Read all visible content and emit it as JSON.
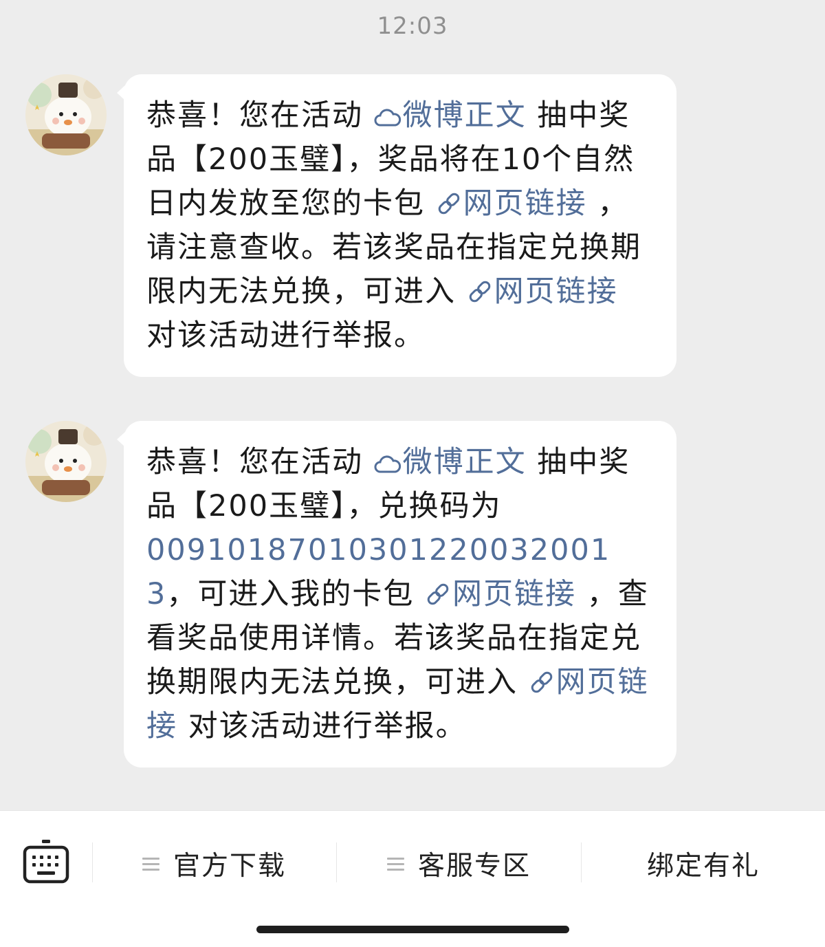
{
  "status": {
    "time": "12:03"
  },
  "messages": [
    {
      "parts": [
        {
          "t": "text",
          "v": "恭喜！您在活动 "
        },
        {
          "t": "weibo",
          "v": "微博正文"
        },
        {
          "t": "text",
          "v": " 抽中奖品【200玉璧】，奖品将在10个自然日内发放至您的卡包 "
        },
        {
          "t": "link",
          "v": "网页链接"
        },
        {
          "t": "text",
          "v": " ，请注意查收。若该奖品在指定兑换期限内无法兑换，可进入 "
        },
        {
          "t": "link",
          "v": "网页链接"
        },
        {
          "t": "text",
          "v": " 对该活动进行举报。"
        }
      ]
    },
    {
      "parts": [
        {
          "t": "text",
          "v": "恭喜！您在活动 "
        },
        {
          "t": "weibo",
          "v": "微博正文"
        },
        {
          "t": "text",
          "v": " 抽中奖品【200玉璧】，兑换码为"
        },
        {
          "t": "code",
          "v": "00910187010301220032001 3"
        },
        {
          "t": "text",
          "v": "，可进入我的卡包 "
        },
        {
          "t": "link",
          "v": "网页链接"
        },
        {
          "t": "text",
          "v": " ，查看奖品使用详情。若该奖品在指定兑换期限内无法兑换，可进入 "
        },
        {
          "t": "link",
          "v": "网页链接"
        },
        {
          "t": "text",
          "v": " 对该活动进行举报。"
        }
      ]
    }
  ],
  "bottom_menu": {
    "items": [
      {
        "label": "官方下载",
        "has_menu": true
      },
      {
        "label": "客服专区",
        "has_menu": true
      },
      {
        "label": "绑定有礼",
        "has_menu": false
      }
    ]
  },
  "colors": {
    "link": "#526e99",
    "background": "#ededed",
    "bubble": "#ffffff"
  },
  "icons": {
    "keyboard": "keyboard-icon",
    "weibo": "weibo-cloud-icon",
    "link": "link-chain-icon",
    "menu": "hamburger-icon"
  }
}
